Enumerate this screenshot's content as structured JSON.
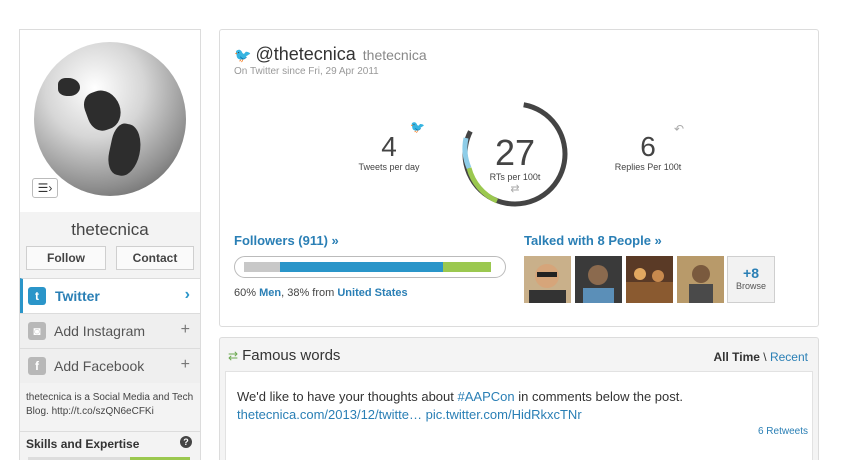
{
  "profile": {
    "name": "thetecnica",
    "follow_label": "Follow",
    "contact_label": "Contact",
    "bio": "thetecnica is a Social Media and Tech Blog. http://t.co/szQN6eCFKi",
    "skills_label": "Skills and Expertise"
  },
  "nav": {
    "twitter": "Twitter",
    "instagram": "Add Instagram",
    "facebook": "Add Facebook"
  },
  "account": {
    "handle": "@thetecnica",
    "username": "thetecnica",
    "since": "On Twitter since Fri, 29 Apr 2011"
  },
  "stats": {
    "tweets_per_day": "4",
    "tweets_per_day_label": "Tweets per day",
    "rts_per_100t": "27",
    "rts_per_100t_label": "RTs per 100t",
    "replies_per_100t": "6",
    "replies_per_100t_label": "Replies Per 100t"
  },
  "followers": {
    "heading": "Followers (911) »",
    "men_pct": "60%",
    "men_label": "Men",
    "country_prefix": ", 38% from",
    "country": "United States",
    "bar": {
      "gray": 0.14,
      "blue": 0.64,
      "green": 0.19
    }
  },
  "talked": {
    "prefix": "Talked with",
    "count": "8",
    "suffix": "People »",
    "more_count": "+8",
    "browse_label": "Browse"
  },
  "famous": {
    "title": "Famous words",
    "tab_all": "All Time",
    "tab_sep": "\\",
    "tab_recent": "Recent",
    "tweet_prefix": "We'd like to have your thoughts about",
    "hashtag": "#AAPCon",
    "tweet_suffix": "in comments below the post.",
    "link1": "thetecnica.com/2013/12/twitte…",
    "link2": "pic.twitter.com/HidRkxcTNr",
    "retweets": "6 Retweets"
  },
  "colors": {
    "accent": "#2a95c9",
    "bar_gray": "#c8c8c8",
    "bar_blue": "#2a95c9",
    "bar_green": "#9bc84f"
  },
  "icons": {
    "twitter": "twitter-bird-icon",
    "instagram": "instagram-icon",
    "facebook": "facebook-icon",
    "retweet": "retweet-icon",
    "reply": "reply-icon",
    "list": "list-icon",
    "help": "question-icon"
  }
}
